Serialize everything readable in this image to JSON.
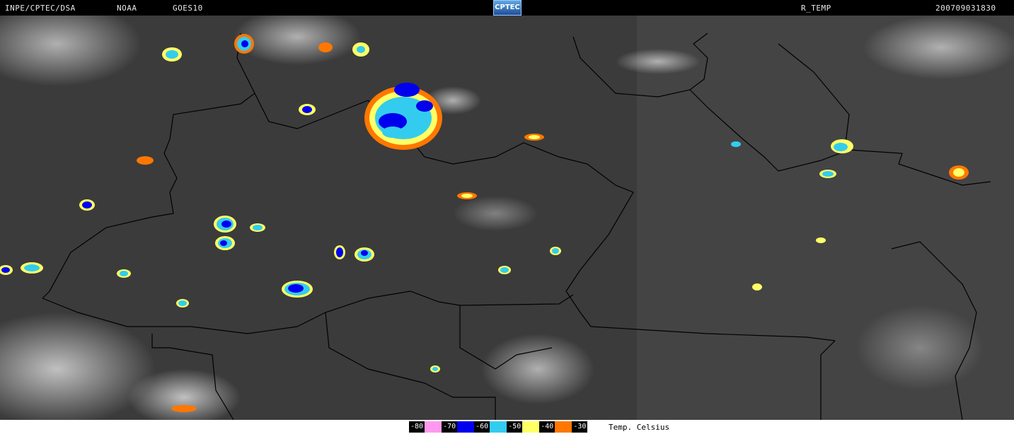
{
  "header": {
    "source": "INPE/CPTEC/DSA",
    "agency": "NOAA",
    "satellite": "GOES10",
    "logo_text": "CPTEC",
    "product": "R_TEMP",
    "timestamp": "200709031830"
  },
  "legend": {
    "entries": [
      {
        "label": "-80",
        "color": "#ff99ee"
      },
      {
        "label": "-70",
        "color": "#0000ee"
      },
      {
        "label": "-60",
        "color": "#33ccee"
      },
      {
        "label": "-50",
        "color": "#ffff66"
      },
      {
        "label": "-40",
        "color": "#ff7700"
      },
      {
        "label": "-30",
        "color": null
      }
    ],
    "unit": "Temp. Celsius"
  },
  "colors": {
    "background": "#3a3a3a",
    "clouds": "#9a9a9a",
    "borders": "#000000"
  }
}
